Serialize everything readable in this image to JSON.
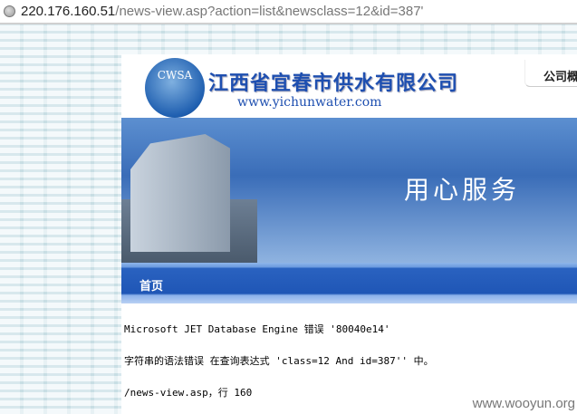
{
  "browser": {
    "url_host": "220.176.160.51",
    "url_path": "/news-view.asp?action=list&newsclass=12&id=387'"
  },
  "header": {
    "logo_text": "CWSA",
    "company_name": "江西省宜春市供水有限公司",
    "website": "www.yichunwater.com",
    "tab_label": "公司概况"
  },
  "banner": {
    "slogan": "用心服务"
  },
  "nav": {
    "home": "首页"
  },
  "error": {
    "line1": "Microsoft JET Database Engine 错误 '80040e14'",
    "line2": "字符串的语法错误 在查询表达式 'class=12 And id=387'' 中。",
    "line3": "/news-view.asp，行 160"
  },
  "watermark": "www.wooyun.org"
}
